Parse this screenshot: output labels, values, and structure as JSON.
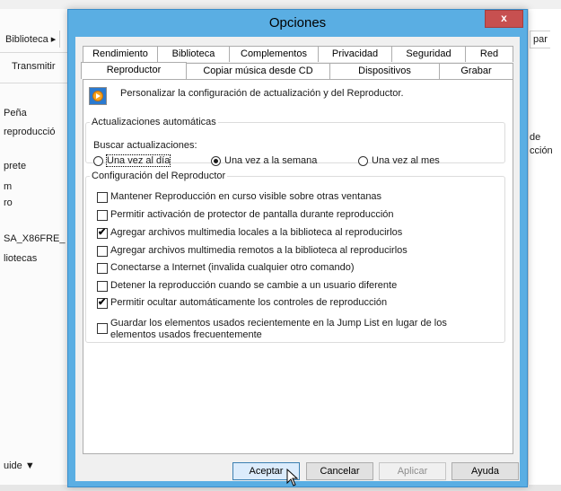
{
  "background": {
    "sidebar_items": [
      "Biblioteca",
      "Transmitir",
      "Peña",
      "reproducció",
      "prete",
      "m",
      "ro",
      "SA_X86FRE_",
      "liotecas",
      "uide"
    ],
    "right_items": [
      "par",
      "de",
      "cción"
    ]
  },
  "dialog": {
    "title": "Opciones",
    "close_label": "x",
    "tabs_row1": [
      "Rendimiento",
      "Biblioteca",
      "Complementos",
      "Privacidad",
      "Seguridad",
      "Red"
    ],
    "tabs_row2": [
      "Reproductor",
      "Copiar música desde CD",
      "Dispositivos",
      "Grabar"
    ],
    "active_tab": "Reproductor",
    "intro": "Personalizar la configuración de actualización y del Reproductor.",
    "updates": {
      "legend": "Actualizaciones automáticas",
      "prompt": "Buscar actualizaciones:",
      "options": [
        "Una vez al día",
        "Una vez a la semana",
        "Una vez al mes"
      ],
      "selected": "Una vez a la semana"
    },
    "config": {
      "legend": "Configuración del Reproductor",
      "options": [
        {
          "label": "Mantener Reproducción en curso visible sobre otras ventanas",
          "checked": false
        },
        {
          "label": "Permitir activación de protector de pantalla durante reproducción",
          "checked": false
        },
        {
          "label": "Agregar archivos multimedia locales a la biblioteca al reproducirlos",
          "checked": true
        },
        {
          "label": "Agregar archivos multimedia remotos a la biblioteca al reproducirlos",
          "checked": false
        },
        {
          "label": "Conectarse a Internet (invalida cualquier otro comando)",
          "checked": false
        },
        {
          "label": "Detener la reproducción cuando se cambie a un usuario diferente",
          "checked": false
        },
        {
          "label": "Permitir ocultar automáticamente los controles de reproducción",
          "checked": true
        },
        {
          "label": "Guardar los elementos usados recientemente en la Jump List en lugar de los elementos usados frecuentemente",
          "checked": false
        }
      ]
    },
    "buttons": {
      "ok": "Aceptar",
      "cancel": "Cancelar",
      "apply": "Aplicar",
      "help": "Ayuda"
    },
    "tick_glyph": "✔"
  }
}
